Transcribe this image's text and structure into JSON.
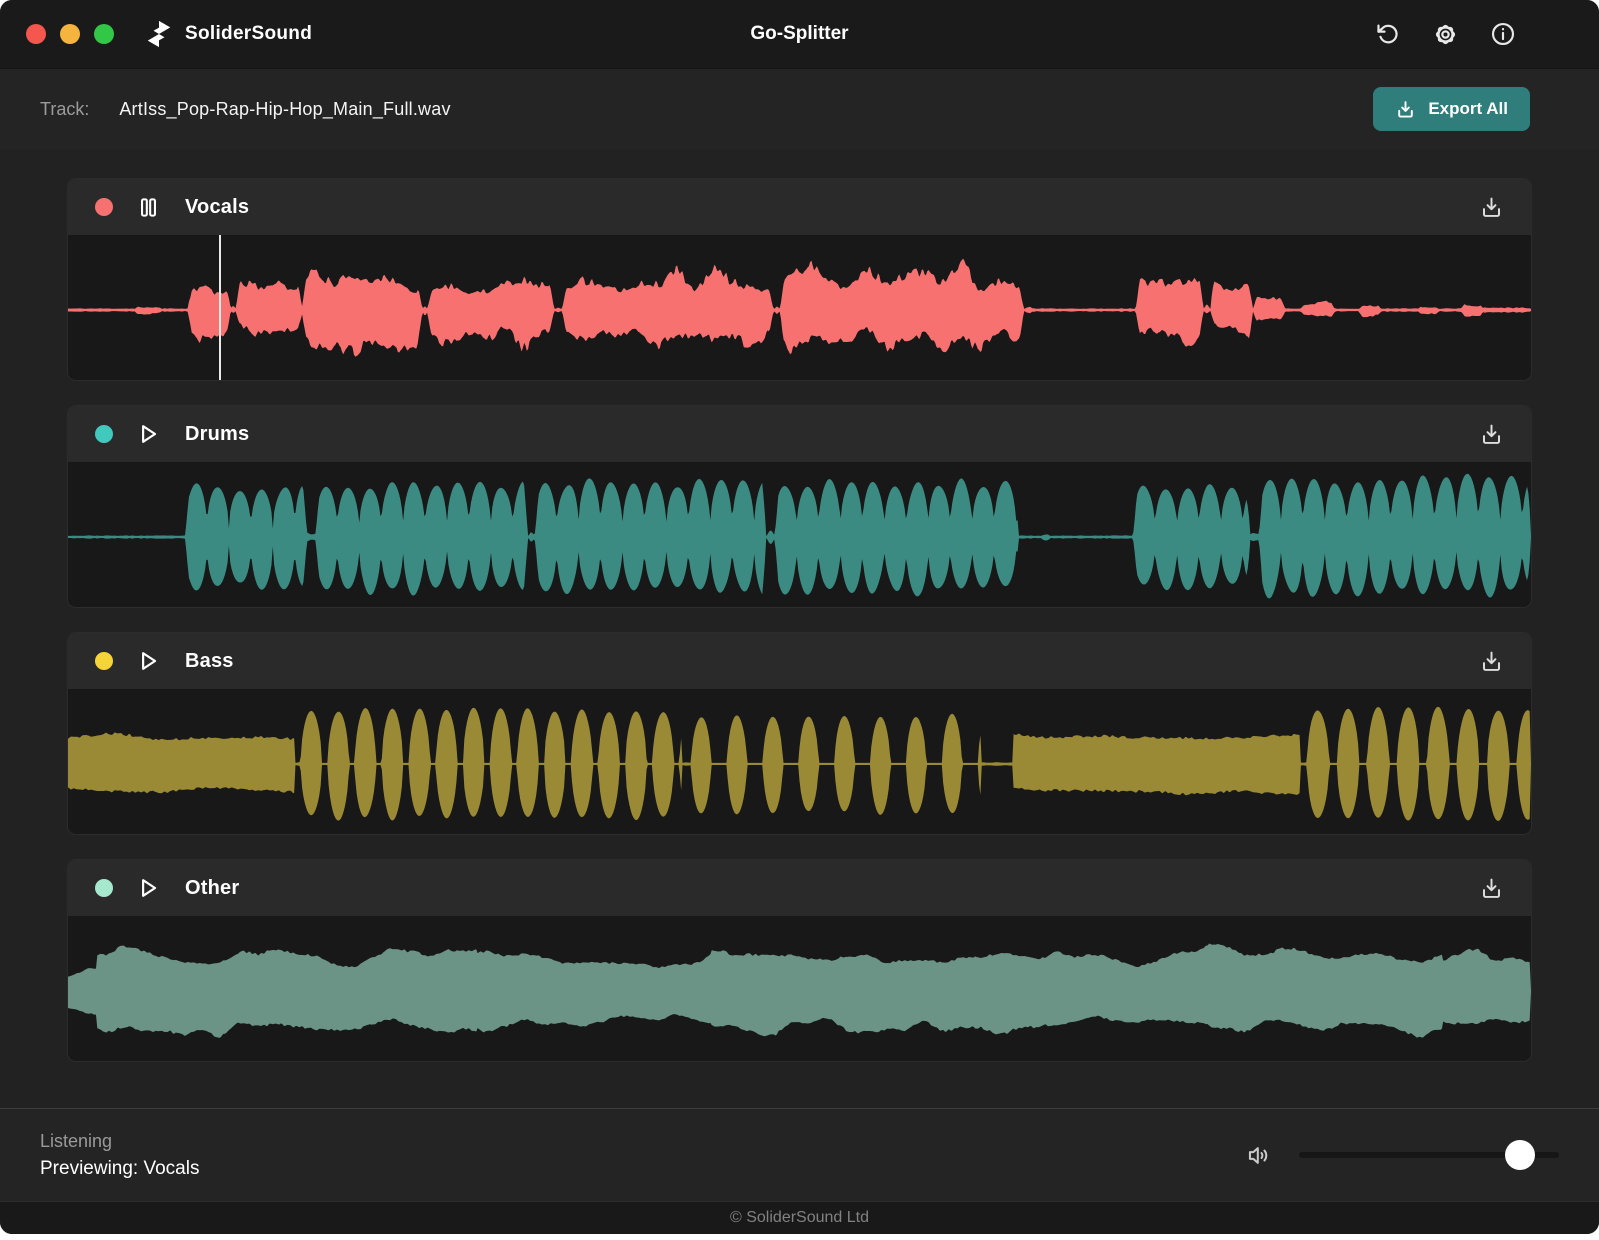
{
  "window": {
    "brand": "SoliderSound",
    "title": "Go-Splitter",
    "footer": "© SoliderSound Ltd"
  },
  "titlebar": {
    "traffic_lights": [
      "#F5574F",
      "#F4B43D",
      "#33C748"
    ],
    "icons": [
      "reset-icon",
      "settings-icon",
      "info-icon"
    ]
  },
  "file_bar": {
    "label": "Track:",
    "filename": "ArtIss_Pop-Rap-Hip-Hop_Main_Full.wav",
    "export_button": "Export All",
    "export_color": "#2F7E7B"
  },
  "status_bar": {
    "state": "Listening",
    "previewing": "Previewing: Vocals",
    "volume_percent": 85
  },
  "tracks": [
    {
      "name": "Vocals",
      "dot_color": "#F87171",
      "wave_color": "#F87171",
      "transport": "pause",
      "playhead_percent": 10.3,
      "seed": 11,
      "segments": [
        [
          0,
          4.5,
          0.02,
          "s"
        ],
        [
          4.5,
          6.5,
          0.07,
          "v"
        ],
        [
          6.5,
          8.2,
          0.02,
          "s"
        ],
        [
          8.2,
          11.1,
          0.55,
          "v"
        ],
        [
          11.1,
          11.5,
          0.12,
          "v"
        ],
        [
          11.5,
          16,
          0.55,
          "v"
        ],
        [
          16,
          24.2,
          0.68,
          "v"
        ],
        [
          24.2,
          24.6,
          0.16,
          "v"
        ],
        [
          24.6,
          33.2,
          0.65,
          "v"
        ],
        [
          33.2,
          33.8,
          0.07,
          "v"
        ],
        [
          33.8,
          48.2,
          0.7,
          "v"
        ],
        [
          48.2,
          48.7,
          0.12,
          "v"
        ],
        [
          48.7,
          65.3,
          0.75,
          "v"
        ],
        [
          65.3,
          66,
          0.07,
          "v"
        ],
        [
          66,
          73,
          0.02,
          "s"
        ],
        [
          73,
          77.6,
          0.55,
          "v"
        ],
        [
          77.6,
          78.1,
          0.12,
          "v"
        ],
        [
          78.1,
          81,
          0.55,
          "v"
        ],
        [
          81,
          83.2,
          0.28,
          "v"
        ],
        [
          83.2,
          84.2,
          0.02,
          "s"
        ],
        [
          84.2,
          86.6,
          0.15,
          "v"
        ],
        [
          86.6,
          88.2,
          0.02,
          "s"
        ],
        [
          88.2,
          89.8,
          0.11,
          "v"
        ],
        [
          89.8,
          92.2,
          0.02,
          "s"
        ],
        [
          92.2,
          93.8,
          0.09,
          "v"
        ],
        [
          93.8,
          95.2,
          0.02,
          "s"
        ],
        [
          95.2,
          96.8,
          0.13,
          "v"
        ],
        [
          96.8,
          100,
          0.03,
          "s"
        ]
      ]
    },
    {
      "name": "Drums",
      "dot_color": "#41C9BE",
      "wave_color": "#3C8B83",
      "transport": "play",
      "playhead_percent": null,
      "seed": 23,
      "segments": [
        [
          0,
          8,
          0.018,
          "s"
        ],
        [
          8,
          16.3,
          0.8,
          "d"
        ],
        [
          16.3,
          16.9,
          0.05,
          "s"
        ],
        [
          16.9,
          31.4,
          0.85,
          "d"
        ],
        [
          31.4,
          31.9,
          0.1,
          "d"
        ],
        [
          31.9,
          47.7,
          0.85,
          "d"
        ],
        [
          47.7,
          48.3,
          0.12,
          "d"
        ],
        [
          48.3,
          65,
          0.85,
          "d"
        ],
        [
          65,
          66.4,
          0.018,
          "s"
        ],
        [
          66.4,
          67.2,
          0.07,
          "v"
        ],
        [
          67.2,
          72.8,
          0.018,
          "s"
        ],
        [
          72.8,
          80.8,
          0.78,
          "d"
        ],
        [
          80.8,
          81.4,
          0.05,
          "s"
        ],
        [
          81.4,
          100,
          0.9,
          "d"
        ]
      ]
    },
    {
      "name": "Bass",
      "dot_color": "#F5D437",
      "wave_color": "#9A8A35",
      "transport": "play",
      "playhead_percent": null,
      "seed": 37,
      "segments": [
        [
          0,
          15.5,
          0.45,
          "f"
        ],
        [
          15.5,
          15.9,
          0.02,
          "s"
        ],
        [
          15.9,
          42,
          0.8,
          "l",
          1.45,
          0.4
        ],
        [
          42,
          42.6,
          0.02,
          "s"
        ],
        [
          42.6,
          62.4,
          0.72,
          "l",
          1.35,
          1.1
        ],
        [
          62.4,
          64.6,
          0.02,
          "s"
        ],
        [
          64.6,
          84.2,
          0.46,
          "f"
        ],
        [
          84.2,
          84.7,
          0.02,
          "s"
        ],
        [
          84.7,
          100,
          0.82,
          "l",
          1.5,
          0.55
        ]
      ]
    },
    {
      "name": "Other",
      "dot_color": "#A6E8CD",
      "wave_color": "#6B9487",
      "transport": "play",
      "playhead_percent": null,
      "seed": 53,
      "segments": [
        [
          0,
          2,
          0.45,
          "n"
        ],
        [
          2,
          28,
          0.72,
          "n"
        ],
        [
          28,
          44,
          0.65,
          "n"
        ],
        [
          44,
          62,
          0.7,
          "n"
        ],
        [
          62,
          78,
          0.72,
          "n"
        ],
        [
          78,
          94,
          0.75,
          "n"
        ],
        [
          94,
          100,
          0.62,
          "n"
        ]
      ]
    }
  ]
}
